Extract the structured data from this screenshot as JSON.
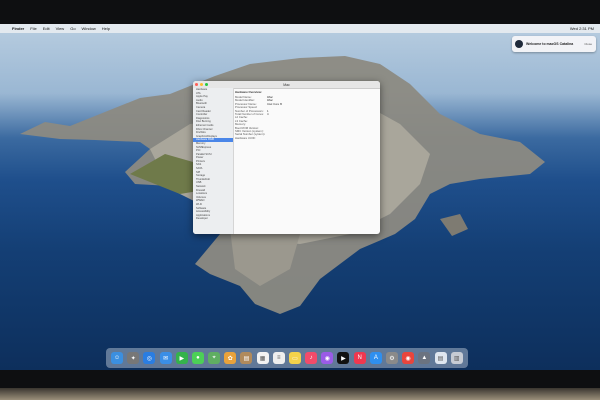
{
  "menubar": {
    "apple": "",
    "finder": "Finder",
    "items": [
      "File",
      "Edit",
      "View",
      "Go",
      "Window",
      "Help"
    ],
    "clock": "Wed 2:31 PM"
  },
  "notification": {
    "title": "Welcome to macOS Catalina",
    "body": "",
    "action": "Close"
  },
  "window": {
    "title": "Mac",
    "sidebar": {
      "items": [
        "Hardware",
        "ATA",
        "Apple Pay",
        "Audio",
        "Bluetooth",
        "Camera",
        "Card Reader",
        "Controller",
        "Diagnostics",
        "Disc Burning",
        "Ethernet Cards",
        "Fibre Channel",
        "FireWire",
        "Graphics/Displays",
        "Hardware RAID",
        "Memory",
        "NVMExpress",
        "PCI",
        "Parallel SCSI",
        "Power",
        "Printers",
        "SAS",
        "SATA",
        "SPI",
        "Storage",
        "Thunderbolt",
        "USB",
        "Network",
        "Firewall",
        "Locations",
        "Volumes",
        "WWAN",
        "Wi-Fi",
        "Software",
        "Accessibility",
        "Applications",
        "Developer"
      ],
      "selected_index": 14
    },
    "content": {
      "heading": "Hardware Overview:",
      "rows": [
        {
          "k": "Model Name:",
          "v": "iMac"
        },
        {
          "k": "Model Identifier:",
          "v": "iMac"
        },
        {
          "k": "Processor Name:",
          "v": "Intel Core i5"
        },
        {
          "k": "Processor Speed:",
          "v": ""
        },
        {
          "k": "Number of Processors:",
          "v": "1"
        },
        {
          "k": "Total Number of Cores:",
          "v": "4"
        },
        {
          "k": "L2 Cache:",
          "v": ""
        },
        {
          "k": "L3 Cache:",
          "v": ""
        },
        {
          "k": "Memory:",
          "v": ""
        },
        {
          "k": "Boot ROM Version:",
          "v": ""
        },
        {
          "k": "SMC Version (system):",
          "v": ""
        },
        {
          "k": "Serial Number (system):",
          "v": ""
        },
        {
          "k": "Hardware UUID:",
          "v": ""
        }
      ],
      "sub_heading": "",
      "sub_rows": [
        {
          "k": "",
          "v": ""
        },
        {
          "k": "",
          "v": ""
        },
        {
          "k": "",
          "v": ""
        },
        {
          "k": "",
          "v": ""
        },
        {
          "k": "",
          "v": ""
        },
        {
          "k": "",
          "v": ""
        },
        {
          "k": "",
          "v": ""
        }
      ]
    }
  },
  "dock": {
    "apps": [
      {
        "name": "finder-icon",
        "glyph": "☺",
        "color": "#3b8fe0"
      },
      {
        "name": "launchpad-icon",
        "glyph": "✦",
        "color": "#777"
      },
      {
        "name": "safari-icon",
        "glyph": "◎",
        "color": "#2a7de1"
      },
      {
        "name": "mail-icon",
        "glyph": "✉",
        "color": "#3a8ee6"
      },
      {
        "name": "facetime-icon",
        "glyph": "▶",
        "color": "#34b24b"
      },
      {
        "name": "messages-icon",
        "glyph": "●",
        "color": "#4ccf57"
      },
      {
        "name": "maps-icon",
        "glyph": "⌖",
        "color": "#5fae62"
      },
      {
        "name": "photos-icon",
        "glyph": "✿",
        "color": "#e9a23b"
      },
      {
        "name": "contacts-icon",
        "glyph": "▤",
        "color": "#b08a5c"
      },
      {
        "name": "calendar-icon",
        "glyph": "▦",
        "color": "#f2f2f2"
      },
      {
        "name": "reminders-icon",
        "glyph": "≡",
        "color": "#eeeeee"
      },
      {
        "name": "notes-icon",
        "glyph": "▭",
        "color": "#f4d24b"
      },
      {
        "name": "music-icon",
        "glyph": "♪",
        "color": "#f24b6a"
      },
      {
        "name": "podcasts-icon",
        "glyph": "◉",
        "color": "#9a5be6"
      },
      {
        "name": "tv-icon",
        "glyph": "▶",
        "color": "#111"
      },
      {
        "name": "news-icon",
        "glyph": "N",
        "color": "#f0374f"
      },
      {
        "name": "app-store-icon",
        "glyph": "A",
        "color": "#2f8fef"
      },
      {
        "name": "system-preferences-icon",
        "glyph": "⚙",
        "color": "#8a8a8a"
      },
      {
        "name": "chrome-icon",
        "glyph": "◉",
        "color": "#e8453c"
      },
      {
        "name": "system-information-icon",
        "glyph": "▲",
        "color": "#6b7380"
      },
      {
        "name": "documents-icon",
        "glyph": "▤",
        "color": "#dfe6ef"
      },
      {
        "name": "trash-icon",
        "glyph": "▥",
        "color": "#c7ccd4"
      }
    ]
  }
}
